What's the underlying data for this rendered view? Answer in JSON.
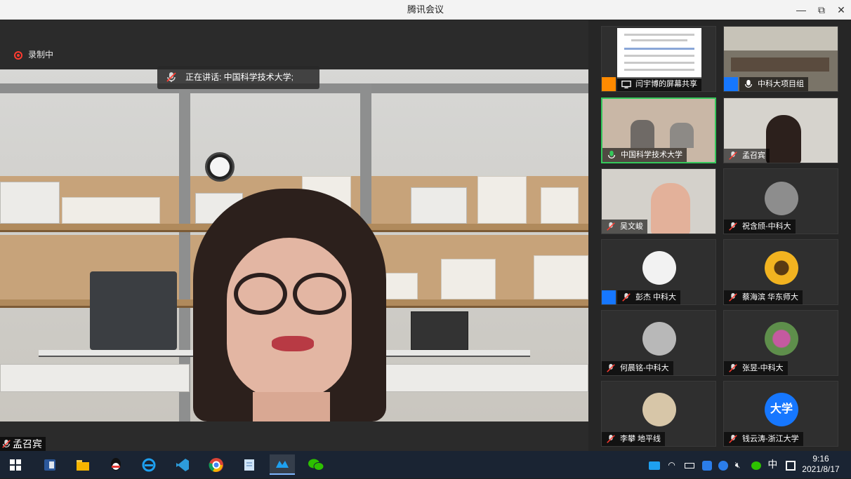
{
  "window": {
    "title": "腾讯会议",
    "minimize_glyph": "—",
    "restore_glyph": "⧉",
    "close_glyph": "✕"
  },
  "main": {
    "recording_label": "录制中",
    "speaking_label": "正在讲话: 中国科学技术大学;",
    "speaker_name": "孟召宾"
  },
  "participants": [
    {
      "name": "闫宇博的屏幕共享",
      "icon": "screen-share",
      "active": false
    },
    {
      "name": "中科大项目组",
      "icon": "mic-on",
      "active": false
    },
    {
      "name": "中国科学技术大学",
      "icon": "mic-speaking",
      "active": true
    },
    {
      "name": "孟召宾",
      "icon": "mic-muted",
      "active": false
    },
    {
      "name": "吴文峻",
      "icon": "mic-muted",
      "active": false
    },
    {
      "name": "祝含颀-中科大",
      "icon": "mic-muted",
      "active": false
    },
    {
      "name": "彭杰 中科大",
      "icon": "mic-muted",
      "active": false
    },
    {
      "name": "蔡海滨 华东师大",
      "icon": "mic-muted",
      "active": false
    },
    {
      "name": "何晨铭-中科大",
      "icon": "mic-muted",
      "active": false
    },
    {
      "name": "张昱-中科大",
      "icon": "mic-muted",
      "active": false
    },
    {
      "name": "李攀 地平线",
      "icon": "mic-muted",
      "active": false
    },
    {
      "name": "钱云涛-浙江大学",
      "icon": "mic-muted",
      "active": false,
      "avatar_text": "大学"
    }
  ],
  "taskbar": {
    "tray_input": "中",
    "time": "9:16",
    "date": "2021/8/17"
  },
  "colors": {
    "accent_blue": "#1677ff",
    "active_green": "#35c85b",
    "record_red": "#ff3b30",
    "taskbar": "#1a2433"
  }
}
